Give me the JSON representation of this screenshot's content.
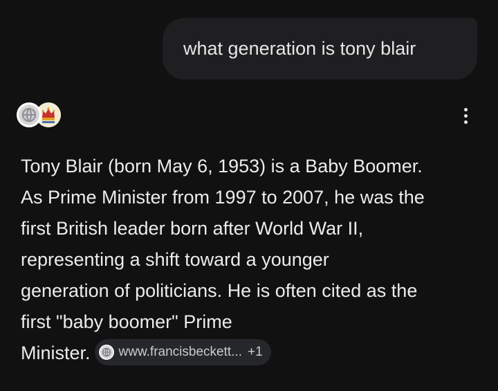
{
  "user_message": {
    "text": "what generation is tony blair"
  },
  "response": {
    "source_icons": [
      "globe-icon",
      "crown-icon"
    ],
    "lines": [
      "Tony Blair (born May 6, 1953) is a Baby Boomer.",
      "As Prime Minister from 1997 to 2007, he was the",
      "first British leader born after World War II,",
      "representing a shift toward a younger",
      "generation of politicians. He is often cited as the",
      "first \"baby boomer\" Prime",
      "Minister."
    ],
    "citation": {
      "icon": "globe-icon",
      "label": "www.francisbeckett...",
      "extra_count": "+1"
    }
  },
  "colors": {
    "background": "#111111",
    "bubble": "#1f1f22",
    "text": "#ececec",
    "chip": "#26272b"
  }
}
